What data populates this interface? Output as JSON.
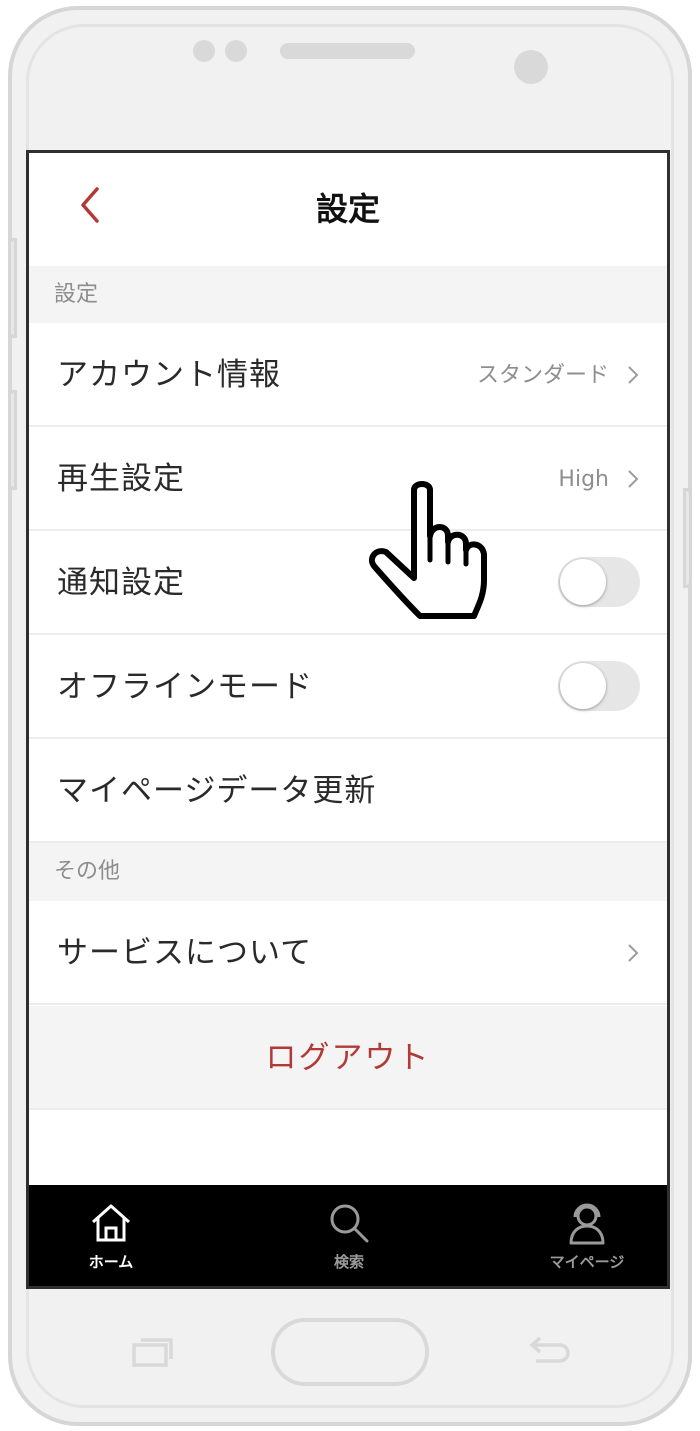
{
  "header": {
    "title": "設定"
  },
  "sections": {
    "settings_label": "設定",
    "other_label": "その他"
  },
  "rows": {
    "account": {
      "label": "アカウント情報",
      "value": "スタンダード"
    },
    "playback": {
      "label": "再生設定",
      "value": "High"
    },
    "notifications": {
      "label": "通知設定",
      "toggle_on": false
    },
    "offline": {
      "label": "オフラインモード",
      "toggle_on": false
    },
    "refresh": {
      "label": "マイページデータ更新"
    },
    "about": {
      "label": "サービスについて"
    }
  },
  "logout": {
    "label": "ログアウト"
  },
  "tabs": [
    {
      "label": "ホーム",
      "icon": "home-icon",
      "active": true
    },
    {
      "label": "検索",
      "icon": "search-icon",
      "active": false
    },
    {
      "label": "マイページ",
      "icon": "user-headset-icon",
      "active": false
    }
  ],
  "colors": {
    "accent": "#b23a36",
    "tab_bar": "#000000",
    "section_bg": "#f4f4f4"
  }
}
